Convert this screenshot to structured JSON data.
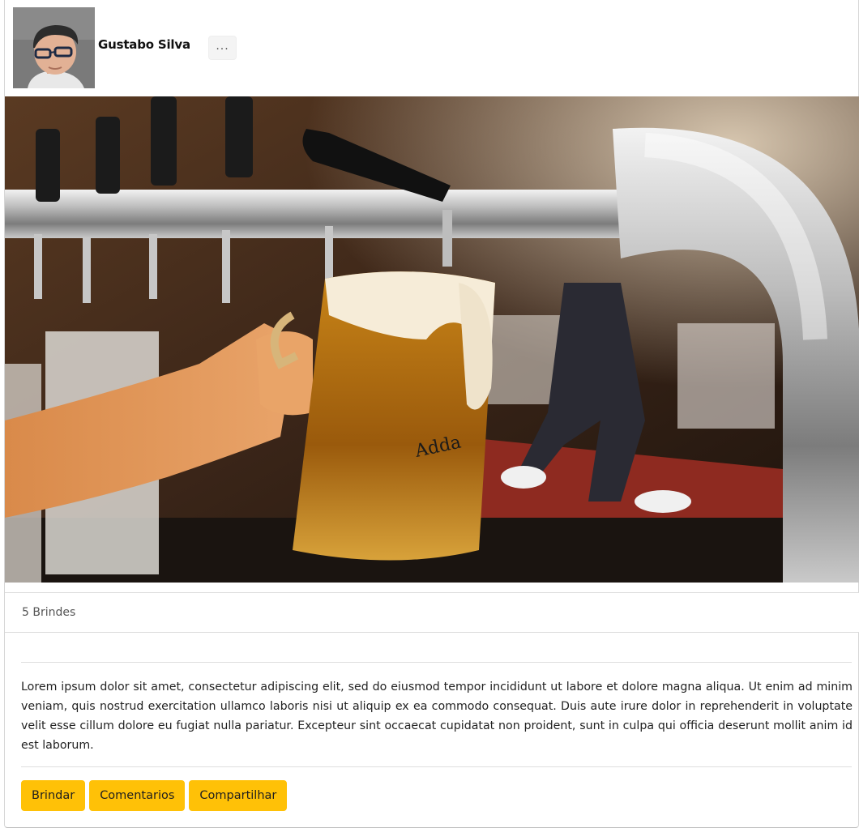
{
  "post": {
    "author": "Gustabo Silva",
    "more_label": "...",
    "toasts": "5 Brindes",
    "body": "Lorem ipsum dolor sit amet, consectetur adipiscing elit, sed do eiusmod tempor incididunt ut labore et dolore magna aliqua. Ut enim ad minim veniam, quis nostrud exercitation ullamco laboris nisi ut aliquip ex ea commodo consequat. Duis aute irure dolor in reprehenderit in voluptate velit esse cillum dolore eu fugiat nulla pariatur. Excepteur sint occaecat cupidatat non proident, sunt in culpa qui officia deserunt mollit anim id est laborum."
  },
  "actions": {
    "toast_label": "Brindar",
    "comments_label": "Comentarios",
    "share_label": "Compartilhar"
  },
  "photo": {
    "mug_text": "Adda"
  },
  "colors": {
    "accent": "#ffc107",
    "border": "#dcdcdc"
  }
}
